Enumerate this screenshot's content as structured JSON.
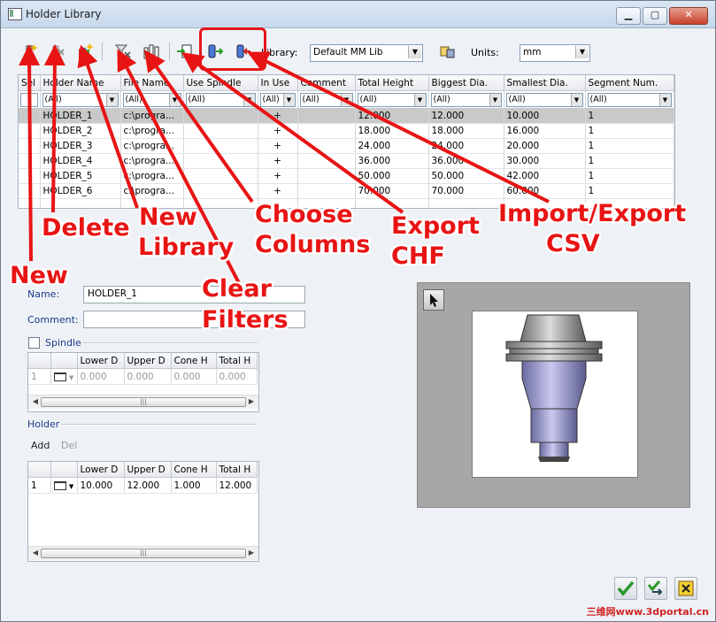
{
  "window": {
    "title": "Holder Library"
  },
  "window_buttons": {
    "minimize": "▁",
    "maximize": "▢",
    "close": "✕"
  },
  "toolbar": {
    "library_label": "Library:",
    "library_value": "Default MM Lib",
    "units_label": "Units:",
    "units_value": "mm"
  },
  "grid": {
    "columns": [
      "Sel",
      "Holder Name",
      "File Name",
      "Use Spindle",
      "In Use",
      "Comment",
      "Total Height",
      "Biggest Dia.",
      "Smallest Dia.",
      "Segment Num."
    ],
    "filter": "(All)",
    "rows": [
      [
        "HOLDER_1",
        "c:\\progra...",
        "",
        "+",
        "",
        "12.000",
        "12.000",
        "10.000",
        "1"
      ],
      [
        "HOLDER_2",
        "c:\\progra...",
        "",
        "+",
        "",
        "18.000",
        "18.000",
        "16.000",
        "1"
      ],
      [
        "HOLDER_3",
        "c:\\progra...",
        "",
        "+",
        "",
        "24.000",
        "24.000",
        "20.000",
        "1"
      ],
      [
        "HOLDER_4",
        "c:\\progra...",
        "",
        "+",
        "",
        "36.000",
        "36.000",
        "30.000",
        "1"
      ],
      [
        "HOLDER_5",
        "c:\\progra...",
        "",
        "+",
        "",
        "50.000",
        "50.000",
        "42.000",
        "1"
      ],
      [
        "HOLDER_6",
        "c:\\progra...",
        "",
        "+",
        "",
        "70.000",
        "70.000",
        "60.000",
        "1"
      ]
    ]
  },
  "form": {
    "name_label": "Name:",
    "name_value": "HOLDER_1",
    "comment_label": "Comment:",
    "comment_value": "",
    "spindle_label": "Spindle",
    "holder_label": "Holder",
    "add_label": "Add",
    "del_label": "Del"
  },
  "spindle_table": {
    "columns": [
      "",
      "",
      "Lower D",
      "Upper D",
      "Cone H",
      "Total H"
    ],
    "row": [
      "1",
      "",
      "0.000",
      "0.000",
      "0.000",
      "0.000"
    ]
  },
  "holder_table": {
    "columns": [
      "",
      "",
      "Lower D",
      "Upper D",
      "Cone H",
      "Total H"
    ],
    "row": [
      "1",
      "",
      "10.000",
      "12.000",
      "1.000",
      "12.000"
    ]
  },
  "annotations": {
    "new": "New",
    "delete": "Delete",
    "new_library_1": "New",
    "new_library_2": "Library",
    "clear_filters_1": "Clear",
    "clear_filters_2": "Filters",
    "choose_columns_1": "Choose",
    "choose_columns_2": "Columns",
    "export_chf_1": "Export",
    "export_chf_2": "CHF",
    "import_export_1": "Import/Export",
    "import_export_2": "CSV"
  },
  "watermark": "三维网www.3dportal.cn",
  "colors": {
    "annotation_red": "#e81414",
    "selected_row": "#c9c9c9",
    "title_bar": "#c7d8ec"
  }
}
